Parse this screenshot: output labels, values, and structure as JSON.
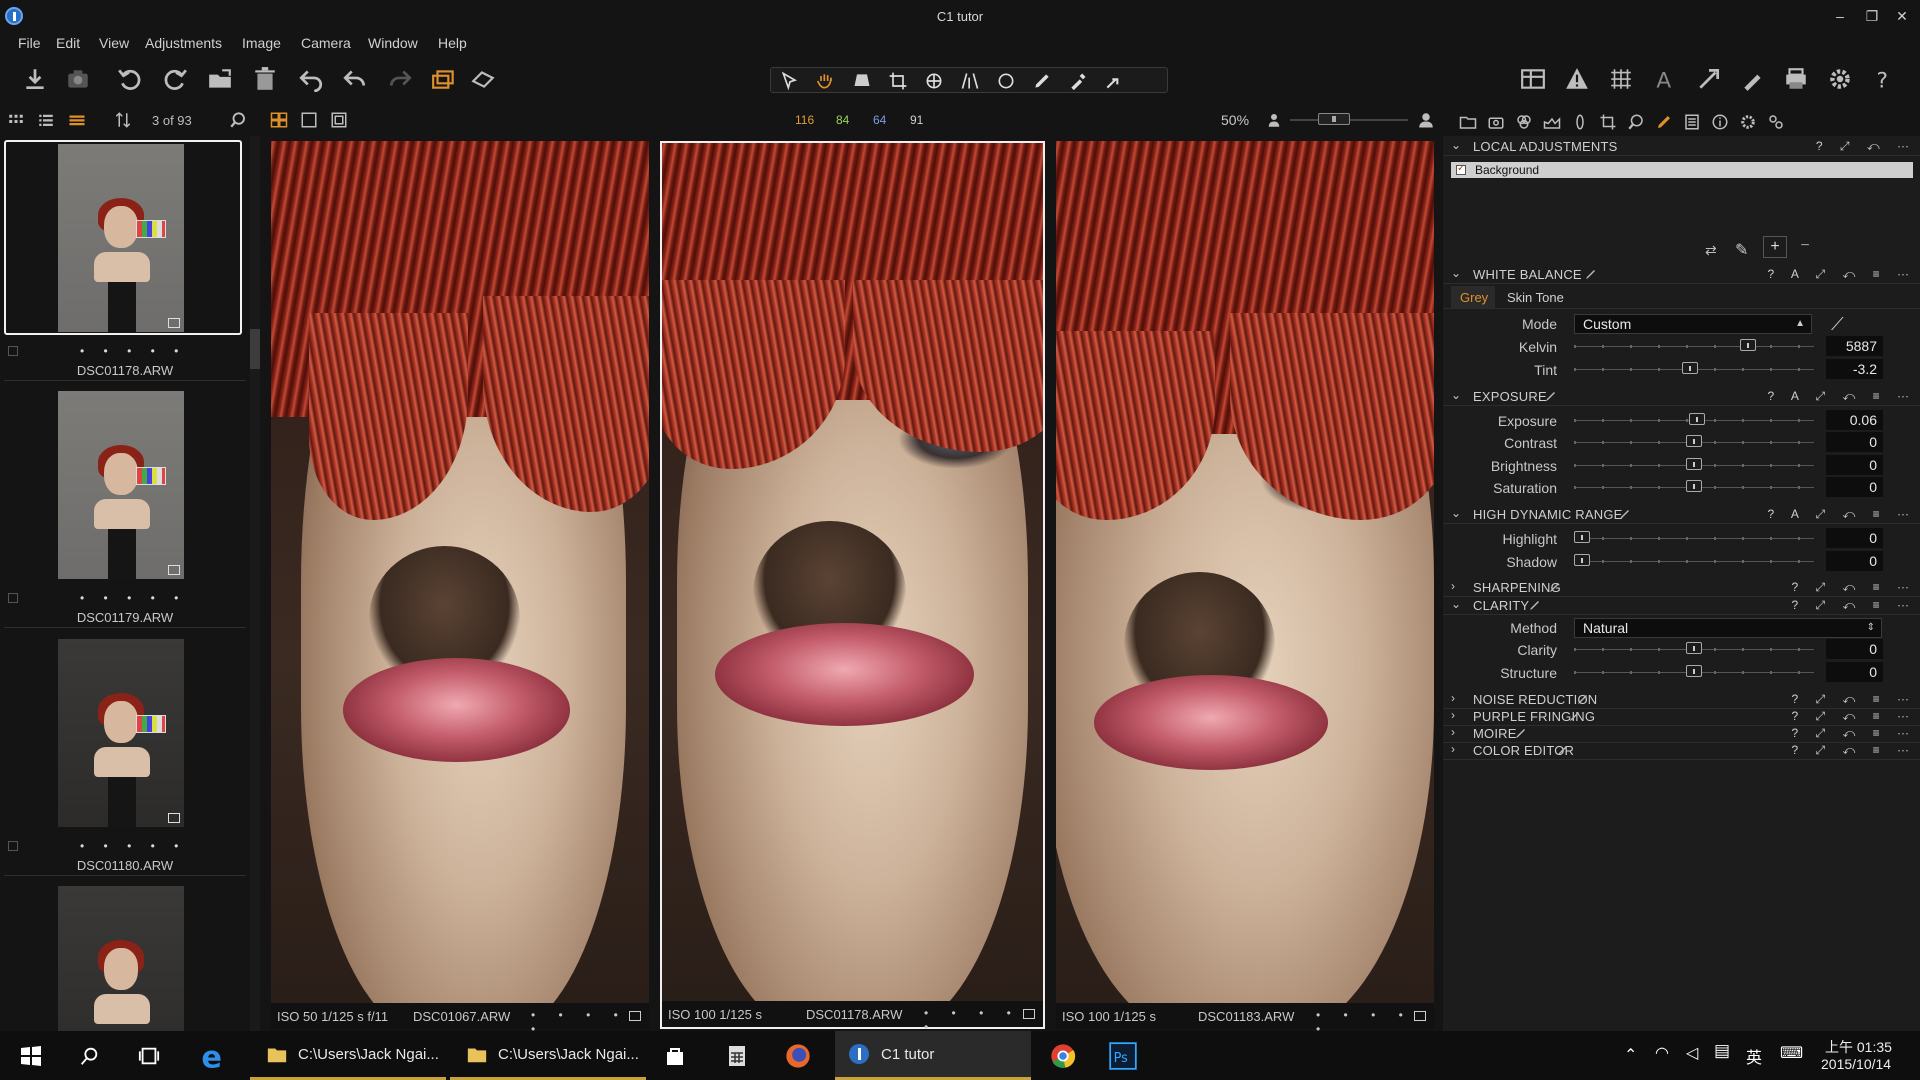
{
  "window": {
    "title": "C1 tutor",
    "minimize": "–",
    "maximize": "❐",
    "close": "✕"
  },
  "menu": [
    "File",
    "Edit",
    "View",
    "Adjustments",
    "Image",
    "Camera",
    "Window",
    "Help"
  ],
  "browser": {
    "count": "3 of 93",
    "ratings": [
      {
        "value": "116",
        "color": "#e39a3a"
      },
      {
        "value": "84",
        "color": "#9bd25a"
      },
      {
        "value": "64",
        "color": "#7f9de0"
      },
      {
        "value": "91",
        "color": "#cfcfcf"
      }
    ],
    "zoom": "50%"
  },
  "filmstrip": [
    {
      "name": "DSC01178.ARW",
      "stars": "• • • • •",
      "selected": true
    },
    {
      "name": "DSC01179.ARW",
      "stars": "• • • • •",
      "selected": false
    },
    {
      "name": "DSC01180.ARW",
      "stars": "• • • • •",
      "selected": false
    },
    {
      "name": "",
      "stars": "",
      "selected": false
    }
  ],
  "viewers": [
    {
      "meta": "ISO 50  1/125 s  f/11",
      "file": "DSC01067.ARW",
      "stars": "• • • • •"
    },
    {
      "meta": "ISO 100  1/125 s",
      "file": "DSC01178.ARW",
      "stars": "• • • • •"
    },
    {
      "meta": "ISO 100  1/125 s",
      "file": "DSC01183.ARW",
      "stars": "• • • • •"
    }
  ],
  "panel": {
    "local_adjustments": {
      "title": "LOCAL ADJUSTMENTS",
      "layer": "Background",
      "ctrls": "? ⤢ ↶ ⋯"
    },
    "white_balance": {
      "title": "WHITE BALANCE",
      "ctrls": "? A ⤢ ↶ ≡ ⋯",
      "tabs": [
        "Grey",
        "Skin Tone"
      ],
      "mode_label": "Mode",
      "mode_value": "Custom",
      "kelvin_label": "Kelvin",
      "kelvin_value": "5887",
      "tint_label": "Tint",
      "tint_value": "-3.2"
    },
    "exposure": {
      "title": "EXPOSURE",
      "ctrls": "? A ⤢ ↶ ≡ ⋯",
      "rows": [
        {
          "label": "Exposure",
          "value": "0.06"
        },
        {
          "label": "Contrast",
          "value": "0"
        },
        {
          "label": "Brightness",
          "value": "0"
        },
        {
          "label": "Saturation",
          "value": "0"
        }
      ]
    },
    "hdr": {
      "title": "HIGH DYNAMIC RANGE",
      "ctrls": "? A ⤢ ↶ ≡ ⋯",
      "rows": [
        {
          "label": "Highlight",
          "value": "0"
        },
        {
          "label": "Shadow",
          "value": "0"
        }
      ]
    },
    "sharpening": {
      "title": "SHARPENING",
      "ctrls": "? ⤢ ↶ ≡ ⋯"
    },
    "clarity": {
      "title": "CLARITY",
      "ctrls": "? ⤢ ↶ ≡ ⋯",
      "method_label": "Method",
      "method_value": "Natural",
      "rows": [
        {
          "label": "Clarity",
          "value": "0"
        },
        {
          "label": "Structure",
          "value": "0"
        }
      ]
    },
    "noise_reduction": {
      "title": "NOISE REDUCTION",
      "ctrls": "? ⤢ ↶ ≡ ⋯"
    },
    "purple_fringing": {
      "title": "PURPLE FRINGING",
      "ctrls": "? ⤢ ↶ ≡ ⋯"
    },
    "moire": {
      "title": "MOIRE",
      "ctrls": "? ⤢ ↶ ≡ ⋯"
    },
    "color_editor": {
      "title": "COLOR EDITOR",
      "ctrls": "? ⤢ ↶ ≡ ⋯"
    }
  },
  "taskbar": {
    "explorer1": "C:\\Users\\Jack Ngai...",
    "explorer2": "C:\\Users\\Jack Ngai...",
    "c1": "C1 tutor",
    "ime": "英",
    "time": "上午 01:35",
    "date": "2015/10/14"
  }
}
